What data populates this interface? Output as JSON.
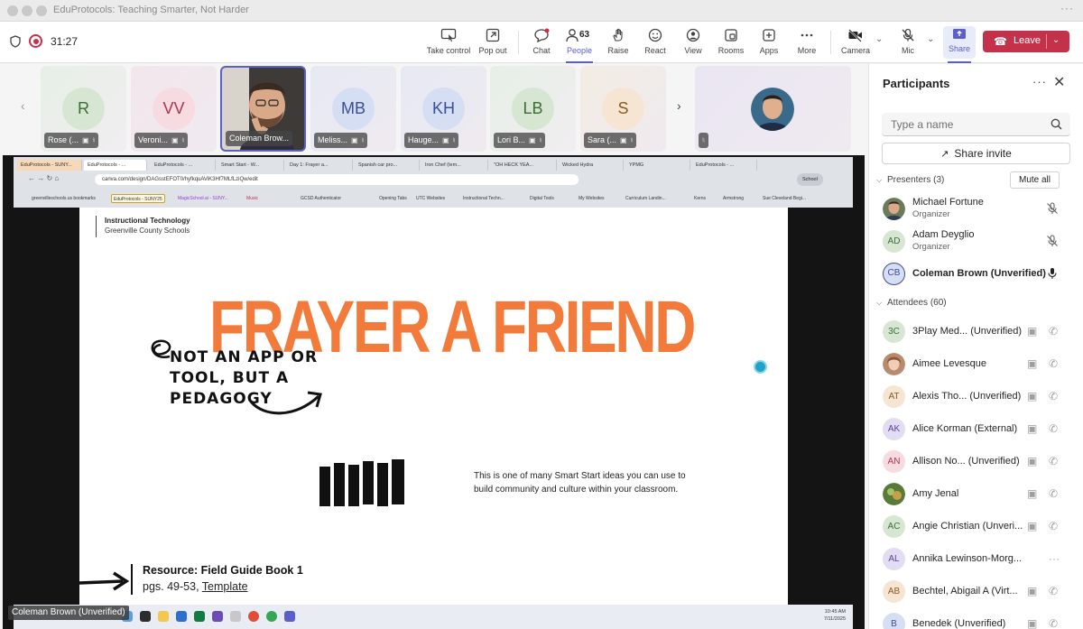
{
  "window": {
    "title": "EduProtocols: Teaching Smarter, Not Harder",
    "menu_icon": "ellipsis-icon"
  },
  "toolbar": {
    "timer": "31:27",
    "take_control": "Take control",
    "pop_out": "Pop out",
    "chat": "Chat",
    "people": "People",
    "people_count": "63",
    "raise": "Raise",
    "react": "React",
    "view": "View",
    "rooms": "Rooms",
    "apps": "Apps",
    "more": "More",
    "camera": "Camera",
    "mic": "Mic",
    "share": "Share",
    "leave": "Leave",
    "accent": "#5b5fc7",
    "leave_color": "#c4314b"
  },
  "tiles": [
    {
      "initials": "R",
      "label": "Rose (...",
      "bg": "#d7e6d2",
      "fg": "#3b6e32"
    },
    {
      "initials": "VV",
      "label": "Veroni...",
      "bg": "#f6dbe1",
      "fg": "#b3344e"
    },
    {
      "initials": "",
      "label": "Coleman Brow..."
    },
    {
      "initials": "MB",
      "label": "Meliss...",
      "bg": "#d6def3",
      "fg": "#3a4f96"
    },
    {
      "initials": "KH",
      "label": "Hauge...",
      "bg": "#d6def3",
      "fg": "#3a4f96"
    },
    {
      "initials": "LB",
      "label": "Lori B...",
      "bg": "#d7e6d2",
      "fg": "#3b6e32"
    },
    {
      "initials": "S",
      "label": "Sara (...",
      "bg": "#f6e5d3",
      "fg": "#8a5a1f"
    }
  ],
  "shared_screen": {
    "browser_tabs": [
      "EduProtocols - SUNY...",
      "EduProtocols - ...",
      "EduProtocols - ...",
      "Smart Start - W...",
      "Day 1: Frayer a...",
      "Spanish car pro...",
      "Iron Chef (tem...",
      "\"OH HECK YEA...",
      "Wicked Hydra",
      "YPMG",
      "EduProtocols - ..."
    ],
    "url": "canva.com/design/DAGsstEFOT0/hyfkquAViK3Hf7MLfLziQw/edit",
    "profile": "School",
    "bookmarks": [
      "greenvilleschools.us bookmarks",
      "EduProtocols - SUNY25",
      "MagicSchool.ai - SUNY...",
      "Music",
      "GCSD Authenticator",
      "Opening Tabs",
      "UTC Websites",
      "Instructional Techn...",
      "Digital Tools",
      "My Websites",
      "Curriculum Landin...",
      "Kerns",
      "Armstrong",
      "Sue Cleveland Begi..."
    ],
    "slide": {
      "org_line1": "Instructional Technology",
      "org_line2": "Greenville County Schools",
      "headline": "FRAYER A FRIEND",
      "scribble_line1": "NOT AN APP OR",
      "scribble_line2": "TOOL, BUT A",
      "scribble_line3": "PEDAGOGY",
      "description": "This is one of many Smart Start ideas you can use to build community and culture within your classroom.",
      "resource_title": "Resource: Field Guide Book 1",
      "resource_pages": "pgs. 49-53, ",
      "resource_link": "Template",
      "headline_color": "#f27a3a"
    },
    "taskbar_time": "10:45 AM",
    "taskbar_date": "7/11/2025",
    "presenter_label": "Coleman Brown (Unverified)"
  },
  "participants": {
    "title": "Participants",
    "search_placeholder": "Type a name",
    "share_invite": "Share invite",
    "presenters_header": "Presenters (3)",
    "mute_all": "Mute all",
    "attendees_header": "Attendees (60)",
    "presenters": [
      {
        "name": "Michael Fortune",
        "role": "Organizer",
        "initials": "",
        "photo": true,
        "mic": "muted"
      },
      {
        "name": "Adam Deyglio",
        "role": "Organizer",
        "initials": "AD",
        "bg": "#d7e6d2",
        "fg": "#3b6e32",
        "mic": "muted"
      },
      {
        "name": "Coleman Brown (Unverified)",
        "role": "",
        "initials": "CB",
        "bg": "#d6def3",
        "fg": "#3a4f96",
        "mic": "on"
      }
    ],
    "attendees": [
      {
        "name": "3Play Med...",
        "suffix": "(Unverified)",
        "initials": "3C",
        "bg": "#d7e6d2",
        "fg": "#3b6e32"
      },
      {
        "name": "Aimee Levesque",
        "suffix": "",
        "initials": "",
        "photo": true
      },
      {
        "name": "Alexis Tho...",
        "suffix": "(Unverified)",
        "initials": "AT",
        "bg": "#f6e5d3",
        "fg": "#8a5a1f"
      },
      {
        "name": "Alice Korman",
        "suffix": "(External)",
        "initials": "AK",
        "bg": "#e3ddf3",
        "fg": "#5b3f96"
      },
      {
        "name": "Allison No...",
        "suffix": "(Unverified)",
        "initials": "AN",
        "bg": "#f6dbe1",
        "fg": "#b3344e"
      },
      {
        "name": "Amy Jenal",
        "suffix": "",
        "initials": "",
        "photo": true
      },
      {
        "name": "Angie Christian",
        "suffix": "(Unveri...",
        "initials": "AC",
        "bg": "#d7e6d2",
        "fg": "#3b6e32"
      },
      {
        "name": "Annika Lewinson-Morg...",
        "suffix": "",
        "initials": "AL",
        "bg": "#e3ddf3",
        "fg": "#5b3f96"
      },
      {
        "name": "Bechtel, Abigail A",
        "suffix": "(Virt...",
        "initials": "AB",
        "bg": "#f6e5d3",
        "fg": "#8a5a1f"
      },
      {
        "name": "Benedek",
        "suffix": "(Unverified)",
        "initials": "B",
        "bg": "#d6def3",
        "fg": "#3a4f96"
      }
    ]
  }
}
